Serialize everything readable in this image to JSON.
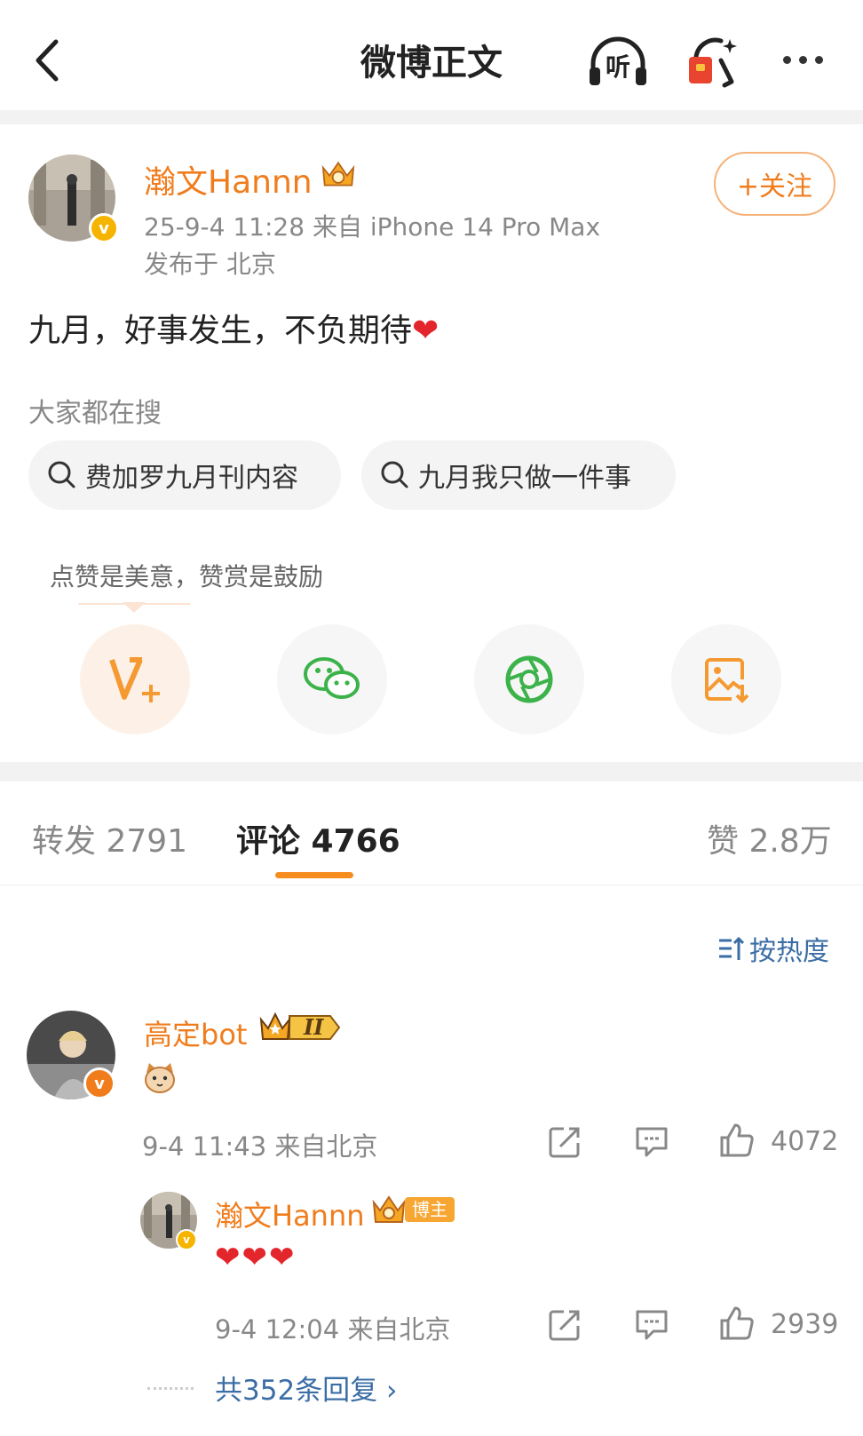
{
  "header": {
    "title": "微博正文",
    "back_icon": "chevron-left-icon",
    "listen_icon": "headphones-listen-icon",
    "listen_label": "听",
    "redpacket_icon": "red-packet-icon",
    "more_icon": "more-icon"
  },
  "post": {
    "author": "瀚文Hannn",
    "meta_line": "25-9-4 11:28  来自 iPhone 14 Pro Max",
    "location": "发布于 北京",
    "follow_label": "+关注",
    "text": "九月，好事发生，不负期待",
    "text_emoji": "❤",
    "verified_color": "#f5b400"
  },
  "trending": {
    "label": "大家都在搜",
    "items": [
      "费加罗九月刊内容",
      "九月我只做一件事"
    ]
  },
  "share": {
    "tip": "点赞是美意，赞赏是鼓励",
    "buttons": [
      "v-plus-icon",
      "wechat-icon",
      "moments-icon",
      "save-image-icon"
    ]
  },
  "tabs": {
    "repost": "转发 2791",
    "comments": "评论 4766",
    "likes": "赞 2.8万"
  },
  "sort_label": "按热度",
  "comments": [
    {
      "name": "高定bot",
      "level": "II",
      "content_emoji": "cat-emoji-icon",
      "time": "9-4 11:43  来自北京",
      "likes": "4072",
      "reply": {
        "name": "瀚文Hannn",
        "badge": "博主",
        "content": "❤❤❤",
        "time": "9-4 12:04  来自北京",
        "likes": "2939"
      }
    }
  ],
  "replies_link": "共352条回复 ›",
  "colors": {
    "accent": "#f07c1c",
    "link": "#3b6ea5",
    "divider": "#f2f2f2"
  }
}
